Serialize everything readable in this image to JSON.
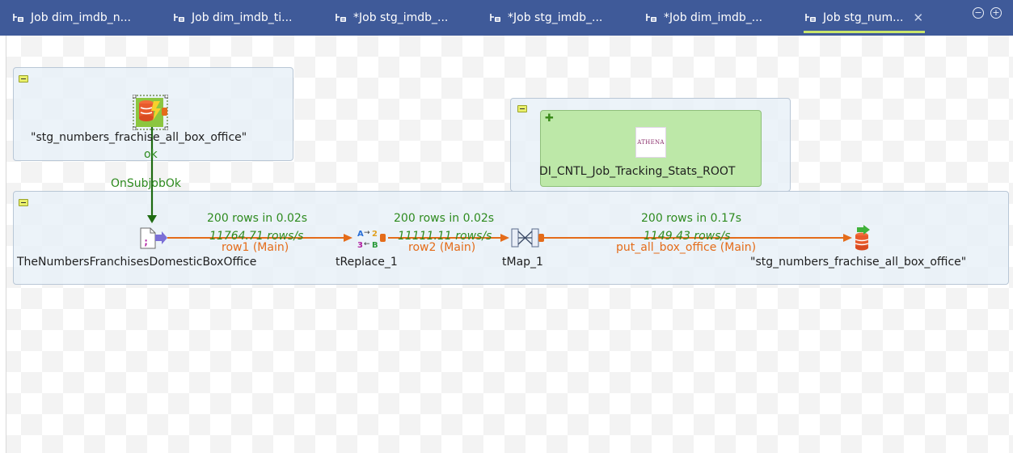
{
  "tabs": [
    {
      "label": "Job dim_imdb_n...",
      "active": false
    },
    {
      "label": "Job dim_imdb_ti...",
      "active": false
    },
    {
      "label": "*Job stg_imdb_...",
      "active": false
    },
    {
      "label": "*Job stg_imdb_...",
      "active": false
    },
    {
      "label": "*Job dim_imdb_...",
      "active": false
    },
    {
      "label": "Job stg_num...",
      "active": true
    }
  ],
  "window_buttons": {
    "minimize": "−",
    "maximize": "+"
  },
  "components": {
    "prejob": "\"stg_numbers_frachise_all_box_office\"",
    "tracking": "DI_CNTL_Job_Tracking_Stats_ROOT",
    "tracking_logo": "ATHENA",
    "input": "TheNumbersFranchisesDomesticBoxOffice",
    "replace": "tReplace_1",
    "map": "tMap_1",
    "output": "\"stg_numbers_frachise_all_box_office\""
  },
  "links": {
    "ok": "ok",
    "subjob_ok": "OnSubjobOk",
    "row1": {
      "stats": "200 rows in 0.02s",
      "rate": "11764.71 rows/s",
      "name": "row1 (Main)"
    },
    "row2": {
      "stats": "200 rows in 0.02s",
      "rate": "11111.11 rows/s",
      "name": "row2 (Main)"
    },
    "out": {
      "stats": "200 rows in 0.17s",
      "rate": "1149.43 rows/s",
      "name": "put_all_box_office (Main)"
    }
  },
  "colors": {
    "tabbar": "#3f5a99",
    "active_tab_underline": "#c9e56b",
    "flow_orange": "#e46c1a",
    "trigger_green": "#1f6b12",
    "stats_green": "#2e8b1f"
  }
}
